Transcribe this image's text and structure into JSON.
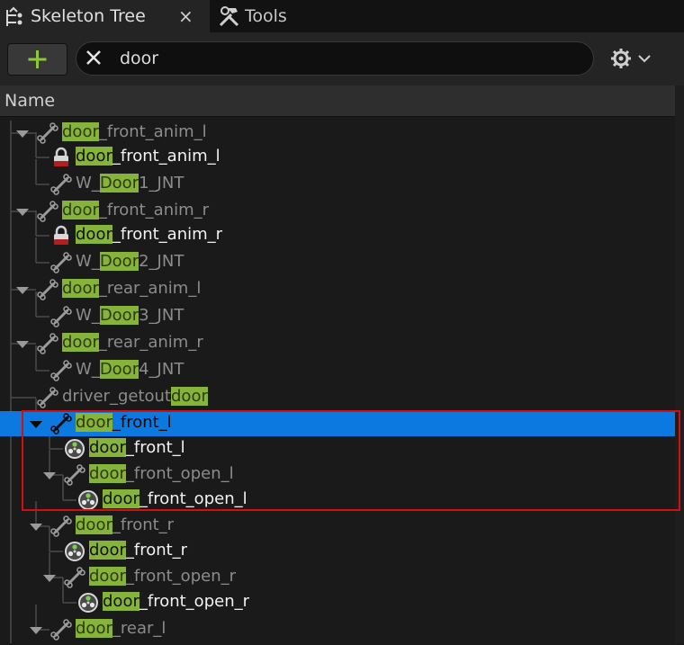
{
  "tabs": [
    {
      "label": "Skeleton Tree",
      "icon": "skeleton-tree-icon",
      "close": "×"
    },
    {
      "label": "Tools",
      "icon": "hammer-wrench-icon"
    }
  ],
  "toolbar": {
    "add_label": "+",
    "search_value": "door",
    "settings_icon": "gear-icon"
  },
  "column_header": "Name",
  "highlight_color": "#86b33a",
  "selection_color": "#0c79e0",
  "rows": [
    {
      "pre": "",
      "match": "door",
      "post": "_front_anim_l",
      "type": "bone",
      "depth": 0,
      "expanded": true,
      "style": "dim"
    },
    {
      "pre": "",
      "match": "door",
      "post": "_front_anim_l",
      "type": "locked",
      "depth": 1,
      "style": "bright"
    },
    {
      "pre": "W_",
      "match": "Door",
      "post": "1_JNT",
      "type": "bone",
      "depth": 1,
      "style": "dim"
    },
    {
      "pre": "",
      "match": "door",
      "post": "_front_anim_r",
      "type": "bone",
      "depth": 0,
      "expanded": true,
      "style": "dim"
    },
    {
      "pre": "",
      "match": "door",
      "post": "_front_anim_r",
      "type": "locked",
      "depth": 1,
      "style": "bright"
    },
    {
      "pre": "W_",
      "match": "Door",
      "post": "2_JNT",
      "type": "bone",
      "depth": 1,
      "style": "dim"
    },
    {
      "pre": "",
      "match": "door",
      "post": "_rear_anim_l",
      "type": "bone",
      "depth": 0,
      "expanded": true,
      "style": "dim"
    },
    {
      "pre": "W_",
      "match": "Door",
      "post": "3_JNT",
      "type": "bone",
      "depth": 1,
      "style": "dim"
    },
    {
      "pre": "",
      "match": "door",
      "post": "_rear_anim_r",
      "type": "bone",
      "depth": 0,
      "expanded": true,
      "style": "dim"
    },
    {
      "pre": "W_",
      "match": "Door",
      "post": "4_JNT",
      "type": "bone",
      "depth": 1,
      "style": "dim"
    },
    {
      "pre": "driver_getout",
      "match": "door",
      "post": "",
      "type": "bone",
      "depth": 0,
      "style": "dim"
    },
    {
      "pre": "",
      "match": "door",
      "post": "_front_l",
      "type": "bone",
      "depth": 1,
      "expanded": true,
      "style": "dim",
      "selected": true
    },
    {
      "pre": "",
      "match": "door",
      "post": "_front_l",
      "type": "socket",
      "depth": 2,
      "style": "bright"
    },
    {
      "pre": "",
      "match": "door",
      "post": "_front_open_l",
      "type": "bone",
      "depth": 2,
      "expanded": true,
      "style": "dim"
    },
    {
      "pre": "",
      "match": "door",
      "post": "_front_open_l",
      "type": "socket",
      "depth": 3,
      "style": "bright"
    },
    {
      "pre": "",
      "match": "door",
      "post": "_front_r",
      "type": "bone",
      "depth": 1,
      "expanded": true,
      "style": "dim"
    },
    {
      "pre": "",
      "match": "door",
      "post": "_front_r",
      "type": "socket",
      "depth": 2,
      "style": "bright"
    },
    {
      "pre": "",
      "match": "door",
      "post": "_front_open_r",
      "type": "bone",
      "depth": 2,
      "expanded": true,
      "style": "dim"
    },
    {
      "pre": "",
      "match": "door",
      "post": "_front_open_r",
      "type": "socket",
      "depth": 3,
      "style": "bright"
    },
    {
      "pre": "",
      "match": "door",
      "post": "_rear_l",
      "type": "bone",
      "depth": 1,
      "expanded": true,
      "style": "dim"
    }
  ]
}
